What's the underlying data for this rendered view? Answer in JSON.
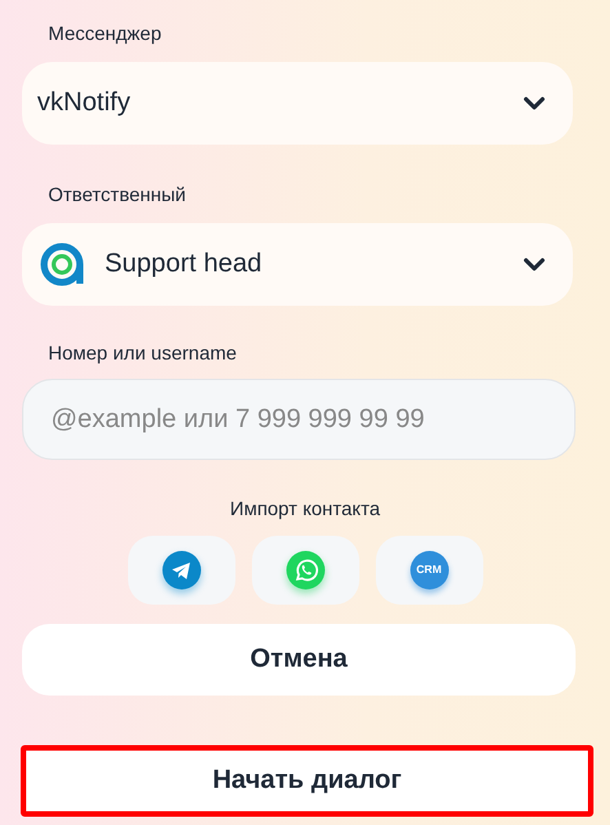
{
  "messenger": {
    "label": "Мессенджер",
    "value": "vkNotify"
  },
  "responsible": {
    "label": "Ответственный",
    "value": "Support head"
  },
  "contact": {
    "label": "Номер или username",
    "placeholder": "@example или 7 999 999 99 99"
  },
  "import": {
    "label": "Импорт контакта",
    "items": [
      {
        "kind": "telegram"
      },
      {
        "kind": "whatsapp"
      },
      {
        "kind": "crm",
        "label": "CRM"
      }
    ]
  },
  "cancel_button": {
    "label": "Отмена"
  },
  "start_button": {
    "label": "Начать диалог",
    "highlighted": true
  }
}
